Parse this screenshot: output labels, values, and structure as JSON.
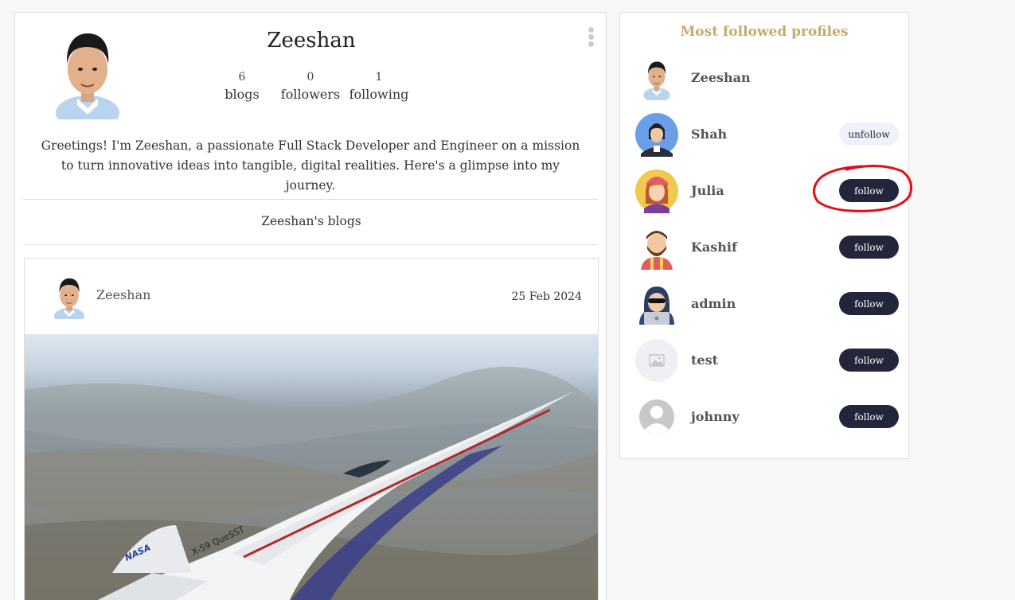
{
  "profile": {
    "name": "Zeeshan",
    "stats": [
      {
        "value": "6",
        "label": "blogs"
      },
      {
        "value": "0",
        "label": "followers"
      },
      {
        "value": "1",
        "label": "following"
      }
    ],
    "bio": "Greetings! I'm Zeeshan, a passionate Full Stack Developer and Engineer on a mission to turn innovative ideas into tangible, digital realities. Here's a glimpse into my journey.",
    "blogs_section_title": "Zeeshan's blogs"
  },
  "post": {
    "author": "Zeeshan",
    "date": "25 Feb 2024",
    "image_text": {
      "aircraft_label": "X-59 QueSST",
      "agency": "NASA"
    }
  },
  "sidebar": {
    "title": "Most followed profiles",
    "profiles": [
      {
        "name": "Zeeshan",
        "avatar": "man-photo-avatar",
        "action": ""
      },
      {
        "name": "Shah",
        "avatar": "hooded-man-avatar",
        "action": "unfollow"
      },
      {
        "name": "Julia",
        "avatar": "woman-avatar",
        "action": "follow"
      },
      {
        "name": "Kashif",
        "avatar": "bearded-man-avatar",
        "action": "follow"
      },
      {
        "name": "admin",
        "avatar": "hacker-laptop-avatar",
        "action": "follow"
      },
      {
        "name": "test",
        "avatar": "image-placeholder-avatar",
        "action": "follow"
      },
      {
        "name": "johnny",
        "avatar": "default-user-avatar",
        "action": "follow"
      }
    ]
  },
  "colors": {
    "accent_title": "#c9a96a",
    "follow_button": "#23263a",
    "unfollow_button": "#eef3fb",
    "annotation": "#e0101a"
  }
}
